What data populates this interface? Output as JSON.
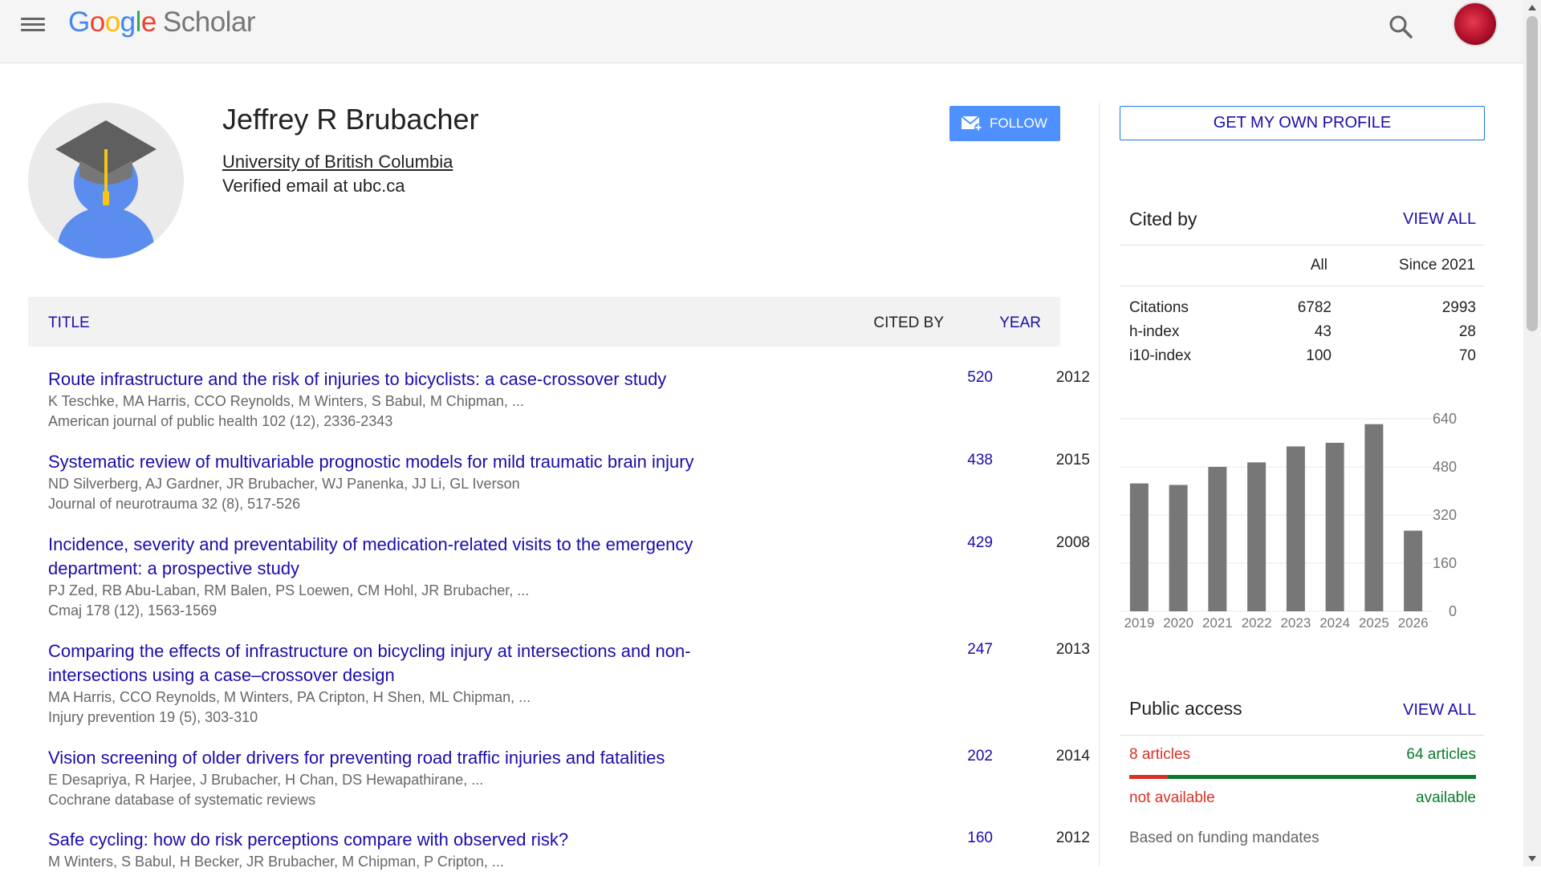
{
  "app": {
    "logo_google": [
      "G",
      "o",
      "o",
      "g",
      "l",
      "e"
    ],
    "logo_scholar": "Scholar"
  },
  "icons": {
    "menu": "hamburger-icon",
    "search": "search-icon",
    "account": "avatar",
    "follow": "mail-plus-icon"
  },
  "profile": {
    "name": "Jeffrey R Brubacher",
    "affiliation": "University of British Columbia",
    "email": "Verified email at ubc.ca",
    "follow_label": "FOLLOW"
  },
  "table": {
    "col_title": "TITLE",
    "col_cited": "CITED BY",
    "col_year": "YEAR"
  },
  "articles": [
    {
      "title": "Route infrastructure and the risk of injuries to bicyclists: a case-crossover study",
      "authors": "K Teschke, MA Harris, CCO Reynolds, M Winters, S Babul, M Chipman, ...",
      "venue": "American journal of public health 102 (12), 2336-2343",
      "cites": "520",
      "year": "2012"
    },
    {
      "title": "Systematic review of multivariable prognostic models for mild traumatic brain injury",
      "authors": "ND Silverberg, AJ Gardner, JR Brubacher, WJ Panenka, JJ Li, GL Iverson",
      "venue": "Journal of neurotrauma 32 (8), 517-526",
      "cites": "438",
      "year": "2015"
    },
    {
      "title": "Incidence, severity and preventability of medication-related visits to the emergency department: a prospective study",
      "authors": "PJ Zed, RB Abu-Laban, RM Balen, PS Loewen, CM Hohl, JR Brubacher, ...",
      "venue": "Cmaj 178 (12), 1563-1569",
      "cites": "429",
      "year": "2008"
    },
    {
      "title": "Comparing the effects of infrastructure on bicycling injury at intersections and non-intersections using a case–crossover design",
      "authors": "MA Harris, CCO Reynolds, M Winters, PA Cripton, H Shen, ML Chipman, ...",
      "venue": "Injury prevention 19 (5), 303-310",
      "cites": "247",
      "year": "2013"
    },
    {
      "title": "Vision screening of older drivers for preventing road traffic injuries and fatalities",
      "authors": "E Desapriya, R Harjee, J Brubacher, H Chan, DS Hewapathirane, ...",
      "venue": "Cochrane database of systematic reviews",
      "cites": "202",
      "year": "2014"
    },
    {
      "title": "Safe cycling: how do risk perceptions compare with observed risk?",
      "authors": "M Winters, S Babul, H Becker, JR Brubacher, M Chipman, P Cripton, ...",
      "venue": "",
      "cites": "160",
      "year": "2012"
    }
  ],
  "sidebar": {
    "get_profile": "GET MY OWN PROFILE",
    "cited_by": {
      "title": "Cited by",
      "view_all": "VIEW ALL",
      "col_all": "All",
      "col_since": "Since 2021",
      "rows": [
        {
          "name": "Citations",
          "all": "6782",
          "since": "2993"
        },
        {
          "name": "h-index",
          "all": "43",
          "since": "28"
        },
        {
          "name": "i10-index",
          "all": "100",
          "since": "70"
        }
      ]
    },
    "public_access": {
      "title": "Public access",
      "view_all": "VIEW ALL",
      "not_available_count": "8 articles",
      "available_count": "64 articles",
      "not_available_label": "not available",
      "available_label": "available",
      "note": "Based on funding mandates",
      "not_available_fraction": 0.111,
      "colors": {
        "not_available": "#d93025",
        "available": "#0a7a2c"
      }
    }
  },
  "chart_data": {
    "type": "bar",
    "categories": [
      "2019",
      "2020",
      "2021",
      "2022",
      "2023",
      "2024",
      "2025",
      "2026"
    ],
    "values": [
      425,
      420,
      480,
      495,
      548,
      560,
      622,
      268
    ],
    "ylim": [
      0,
      640
    ],
    "yticks": [
      0,
      160,
      320,
      480,
      640
    ],
    "y_axis_side": "right",
    "grid": true,
    "bar_color": "#777777"
  }
}
